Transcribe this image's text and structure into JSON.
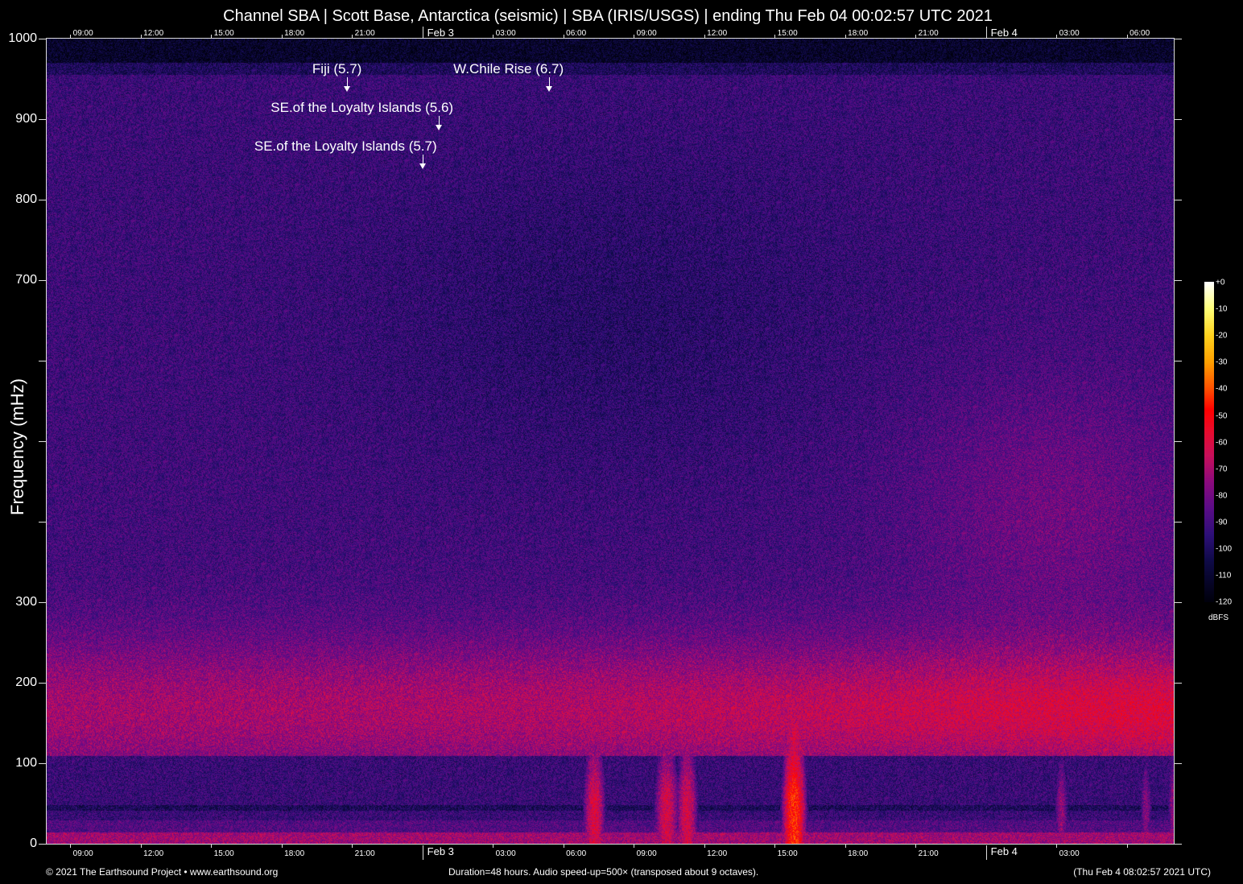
{
  "title": "Channel SBA | Scott Base, Antarctica (seismic) | SBA (IRIS/USGS) | ending Thu Feb 04 00:02:57 UTC 2021",
  "chart_data": {
    "type": "heatmap",
    "title": "Channel SBA | Scott Base, Antarctica (seismic) | SBA (IRIS/USGS) | ending Thu Feb 04 00:02:57 UTC 2021",
    "ylabel": "Frequency (mHz)",
    "ylim": [
      0,
      1000
    ],
    "y_ticks": [
      0,
      100,
      200,
      300,
      400,
      500,
      600,
      700,
      800,
      900,
      1000
    ],
    "y_tick_labels": [
      "0",
      "100",
      "200",
      "300",
      "",
      "",
      "",
      "700",
      "800",
      "900",
      "1000"
    ],
    "x_range_hours": [
      0,
      48
    ],
    "x_ticks_top": [
      {
        "h": 1,
        "label": "09:00"
      },
      {
        "h": 4,
        "label": "12:00"
      },
      {
        "h": 7,
        "label": "15:00"
      },
      {
        "h": 10,
        "label": "18:00"
      },
      {
        "h": 13,
        "label": "21:00"
      },
      {
        "h": 16,
        "label": "Feb  3",
        "date": true
      },
      {
        "h": 19,
        "label": "03:00"
      },
      {
        "h": 22,
        "label": "06:00"
      },
      {
        "h": 25,
        "label": "09:00"
      },
      {
        "h": 28,
        "label": "12:00"
      },
      {
        "h": 31,
        "label": "15:00"
      },
      {
        "h": 34,
        "label": "18:00"
      },
      {
        "h": 37,
        "label": "21:00"
      },
      {
        "h": 40,
        "label": "Feb  4",
        "date": true
      },
      {
        "h": 43,
        "label": "03:00"
      },
      {
        "h": 46,
        "label": "06:00"
      }
    ],
    "x_ticks_bottom": [
      {
        "h": 1,
        "label": "09:00"
      },
      {
        "h": 4,
        "label": "12:00"
      },
      {
        "h": 7,
        "label": "15:00"
      },
      {
        "h": 10,
        "label": "18:00"
      },
      {
        "h": 13,
        "label": "21:00"
      },
      {
        "h": 16,
        "label": "Feb  3",
        "date": true
      },
      {
        "h": 19,
        "label": "03:00"
      },
      {
        "h": 22,
        "label": "06:00"
      },
      {
        "h": 25,
        "label": "09:00"
      },
      {
        "h": 28,
        "label": "12:00"
      },
      {
        "h": 31,
        "label": "15:00"
      },
      {
        "h": 34,
        "label": "18:00"
      },
      {
        "h": 37,
        "label": "21:00"
      },
      {
        "h": 40,
        "label": "Feb  4",
        "date": true
      },
      {
        "h": 43,
        "label": "03:00"
      },
      {
        "h": 46,
        "label": ""
      }
    ],
    "events": [
      {
        "label": "Fiji (5.7)",
        "h": 12.8,
        "row": 0
      },
      {
        "label": "W.Chile Rise (6.7)",
        "h": 21.4,
        "row": 0
      },
      {
        "label": "SE.of the Loyalty Islands (5.6)",
        "h": 16.7,
        "row": 1
      },
      {
        "label": "SE.of the Loyalty Islands (5.7)",
        "h": 16.0,
        "row": 2
      }
    ],
    "colorbar": {
      "unit": "dBFS",
      "range": [
        -120,
        0
      ],
      "ticks": [
        "+0",
        "-10",
        "-20",
        "-30",
        "-40",
        "-50",
        "-60",
        "-70",
        "-80",
        "-90",
        "-100",
        "-110",
        "-120"
      ]
    }
  },
  "footer": {
    "left": "© 2021 The Earthsound Project • www.earthsound.org",
    "center": "Duration=48 hours. Audio speed-up=500× (transposed about 9 octaves).",
    "right": "(Thu Feb  4 08:02:57 2021 UTC)"
  }
}
